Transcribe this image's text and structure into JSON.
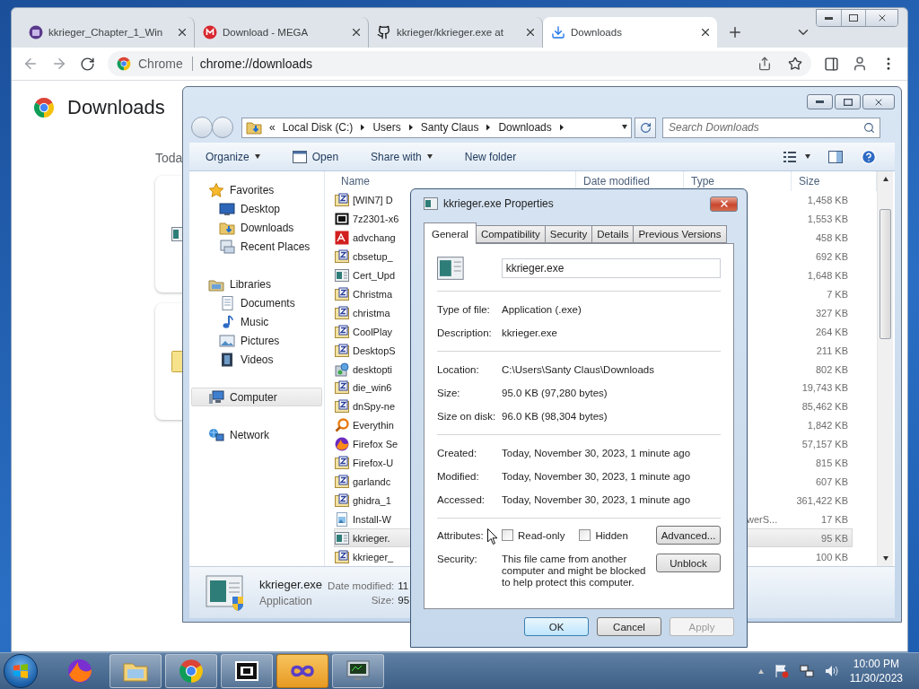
{
  "browser": {
    "tabs": [
      {
        "label": "kkrieger_Chapter_1_Win",
        "kind": "game",
        "selected": false
      },
      {
        "label": "Download - MEGA",
        "kind": "mega",
        "selected": false
      },
      {
        "label": "kkrieger/kkrieger.exe at",
        "kind": "github",
        "selected": false
      },
      {
        "label": "Downloads",
        "kind": "download",
        "selected": true
      }
    ],
    "omnibox": {
      "chip": "Chrome",
      "url": "chrome://downloads"
    },
    "page": {
      "title": "Downloads",
      "section": "Toda",
      "cards": [
        {
          "kind": "app"
        },
        {
          "kind": "folder"
        }
      ]
    }
  },
  "explorer": {
    "path_overflow": "«",
    "path": [
      "Local Disk (C:)",
      "Users",
      "Santy Claus",
      "Downloads"
    ],
    "search_placeholder": "Search Downloads",
    "toolbar": [
      {
        "label": "Organize",
        "kind": "menu"
      },
      {
        "label": "Open",
        "kind": "open"
      },
      {
        "label": "Share with",
        "kind": "menu"
      },
      {
        "label": "New folder",
        "kind": "plain"
      }
    ],
    "nav": [
      {
        "label": "Favorites",
        "kind": "star",
        "selected": false,
        "children": [
          {
            "label": "Desktop",
            "kind": "desktop",
            "selected": false
          },
          {
            "label": "Downloads",
            "kind": "downloads",
            "selected": false
          },
          {
            "label": "Recent Places",
            "kind": "recent",
            "selected": false
          }
        ]
      },
      {
        "label": "Libraries",
        "kind": "libraries",
        "selected": false,
        "children": [
          {
            "label": "Documents",
            "kind": "documents",
            "selected": false
          },
          {
            "label": "Music",
            "kind": "music",
            "selected": false
          },
          {
            "label": "Pictures",
            "kind": "pictures",
            "selected": false
          },
          {
            "label": "Videos",
            "kind": "videos",
            "selected": false
          }
        ]
      },
      {
        "label": "Computer",
        "kind": "computer",
        "selected": true
      },
      {
        "label": "Network",
        "kind": "network",
        "selected": false
      }
    ],
    "columns": [
      "Name",
      "Date modified",
      "Type",
      "Size"
    ],
    "files": [
      {
        "name": "[WIN7] D",
        "kind": "archive",
        "size": "1,458 KB",
        "selected": false
      },
      {
        "name": "7z2301-x6",
        "kind": "sevenzip",
        "size": "1,553 KB",
        "selected": false
      },
      {
        "name": "advchang",
        "kind": "pdf",
        "size": "458 KB",
        "selected": false
      },
      {
        "name": "cbsetup_",
        "kind": "archive",
        "size": "692 KB",
        "selected": false
      },
      {
        "name": "Cert_Upd",
        "kind": "app",
        "size": "1,648 KB",
        "selected": false
      },
      {
        "name": "Christma",
        "kind": "archive",
        "size": "7 KB",
        "selected": false
      },
      {
        "name": "christma",
        "kind": "archive",
        "size": "327 KB",
        "selected": false
      },
      {
        "name": "CoolPlay",
        "kind": "archive",
        "size": "264 KB",
        "selected": false
      },
      {
        "name": "DesktopS",
        "kind": "archive",
        "size": "211 KB",
        "selected": false
      },
      {
        "name": "desktopti",
        "kind": "installer",
        "size": "802 KB",
        "selected": false
      },
      {
        "name": "die_win6",
        "kind": "archive",
        "size": "19,743 KB",
        "selected": false
      },
      {
        "name": "dnSpy-ne",
        "kind": "archive",
        "size": "85,462 KB",
        "selected": false
      },
      {
        "name": "Everythin",
        "kind": "search",
        "size": "1,842 KB",
        "selected": false
      },
      {
        "name": "Firefox Se",
        "kind": "firefox",
        "size": "57,157 KB",
        "selected": false
      },
      {
        "name": "Firefox-U",
        "kind": "archive",
        "size": "815 KB",
        "selected": false
      },
      {
        "name": "garlandc",
        "kind": "archive",
        "size": "607 KB",
        "selected": false
      },
      {
        "name": "ghidra_1",
        "kind": "archive",
        "size": "361,422 KB",
        "selected": false
      },
      {
        "name": "Install-W",
        "kind": "image",
        "type": "werS...",
        "size": "17 KB",
        "selected": false
      },
      {
        "name": "kkrieger.",
        "kind": "app",
        "size": "95 KB",
        "selected": true
      },
      {
        "name": "kkrieger_",
        "kind": "archive",
        "size": "100 KB",
        "selected": false
      }
    ],
    "details": {
      "name": "kkrieger.exe",
      "type": "Application",
      "date_label": "Date modified:",
      "date_value": "11",
      "size_label": "Size:",
      "size_value": "95"
    }
  },
  "dialog": {
    "title": "kkrieger.exe Properties",
    "tabs": [
      {
        "label": "General",
        "selected": true
      },
      {
        "label": "Compatibility",
        "selected": false
      },
      {
        "label": "Security",
        "selected": false
      },
      {
        "label": "Details",
        "selected": false
      },
      {
        "label": "Previous Versions",
        "selected": false
      }
    ],
    "name": "kkrieger.exe",
    "groups": [
      [
        {
          "label": "Type of file:",
          "value": "Application (.exe)"
        },
        {
          "label": "Description:",
          "value": "kkrieger.exe"
        }
      ],
      [
        {
          "label": "Location:",
          "value": "C:\\Users\\Santy Claus\\Downloads"
        },
        {
          "label": "Size:",
          "value": "95.0 KB (97,280 bytes)"
        },
        {
          "label": "Size on disk:",
          "value": "96.0 KB (98,304 bytes)"
        }
      ],
      [
        {
          "label": "Created:",
          "value": "Today, November 30, 2023, 1 minute ago"
        },
        {
          "label": "Modified:",
          "value": "Today, November 30, 2023, 1 minute ago"
        },
        {
          "label": "Accessed:",
          "value": "Today, November 30, 2023, 1 minute ago"
        }
      ]
    ],
    "attributes": {
      "label": "Attributes:",
      "options": [
        {
          "label": "Read-only",
          "checked": false
        },
        {
          "label": "Hidden",
          "checked": false
        }
      ],
      "button": "Advanced..."
    },
    "security": {
      "label": "Security:",
      "text": "This file came from another computer and might be blocked to help protect this computer.",
      "button": "Unblock"
    },
    "buttons": [
      {
        "label": "OK",
        "default": true,
        "disabled": false
      },
      {
        "label": "Cancel",
        "default": false,
        "disabled": false
      },
      {
        "label": "Apply",
        "default": false,
        "disabled": true
      }
    ]
  },
  "taskbar": {
    "apps": [
      {
        "kind": "firefox",
        "running": false,
        "highlighted": false
      },
      {
        "kind": "explorer",
        "running": true,
        "highlighted": false
      },
      {
        "kind": "chrome",
        "running": true,
        "highlighted": false
      },
      {
        "kind": "sevenzip",
        "running": true,
        "highlighted": false
      },
      {
        "kind": "infinity",
        "running": true,
        "highlighted": true
      },
      {
        "kind": "monitor",
        "running": true,
        "highlighted": false
      }
    ],
    "clock": {
      "time": "10:00 PM",
      "date": "11/30/2023"
    }
  }
}
